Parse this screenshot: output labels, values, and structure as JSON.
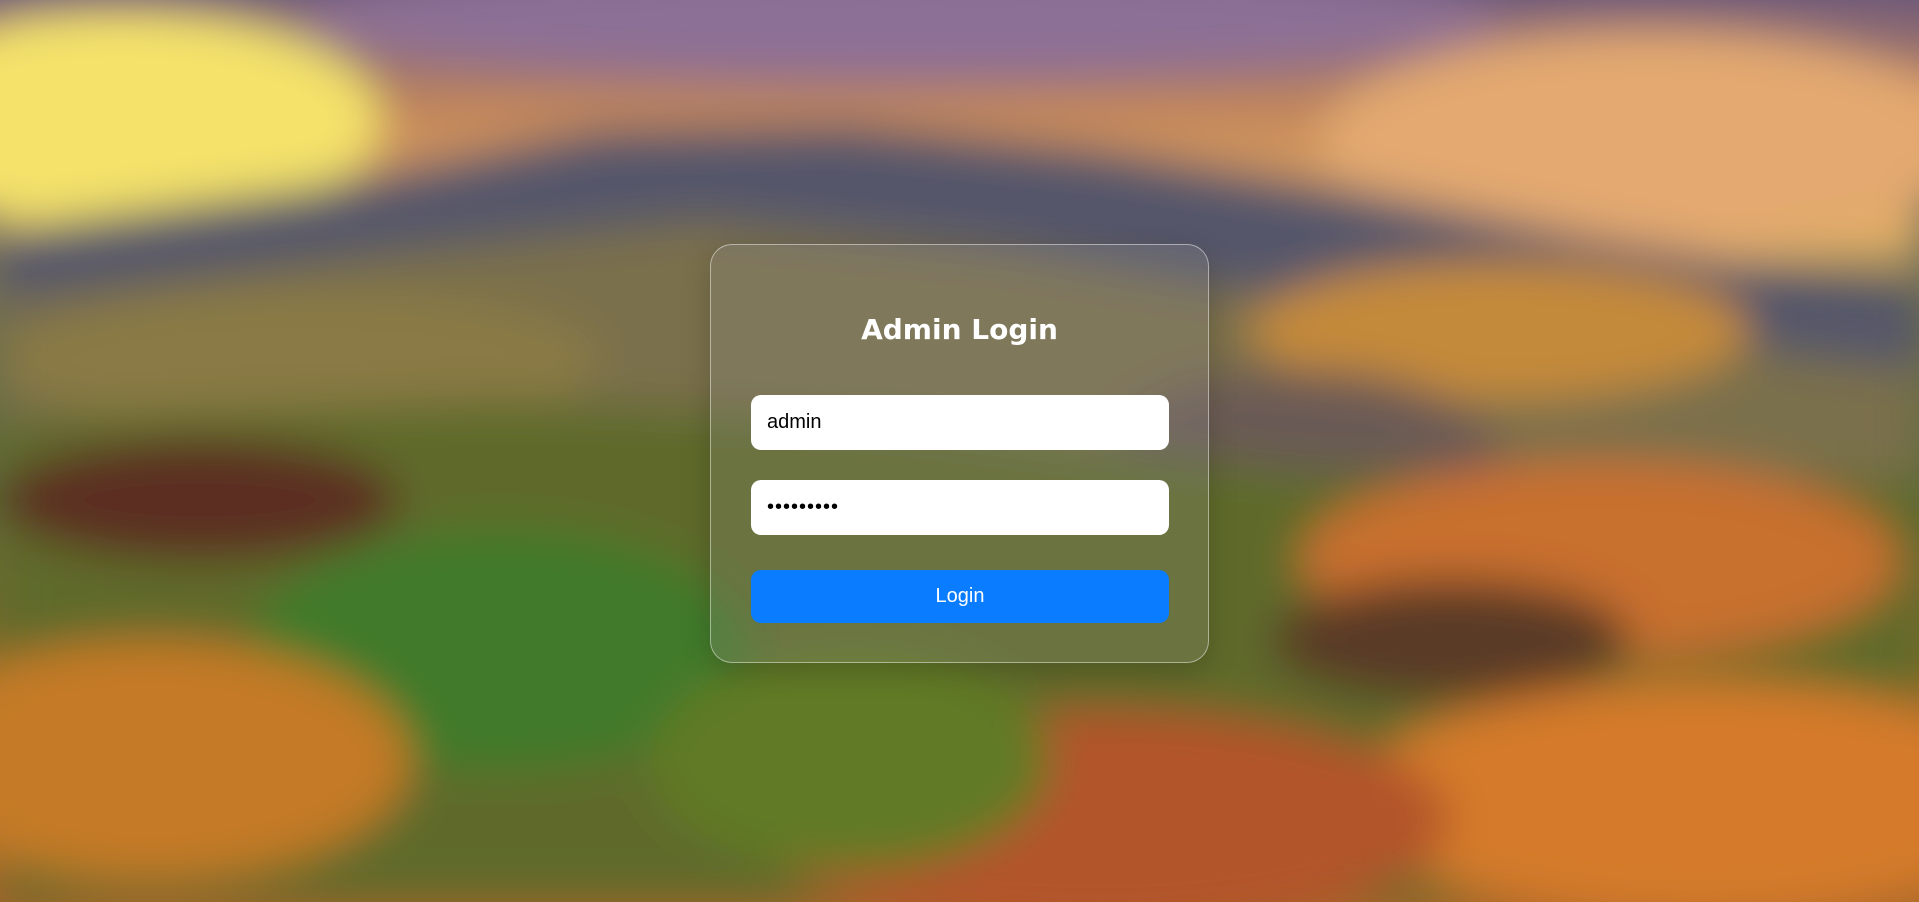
{
  "login": {
    "title": "Admin Login",
    "username_value": "admin",
    "password_value": "•••••••••",
    "button_label": "Login"
  },
  "colors": {
    "button": "#0a7cff",
    "card_border": "rgba(255,255,255,0.45)",
    "text_on_card": "#ffffff"
  }
}
